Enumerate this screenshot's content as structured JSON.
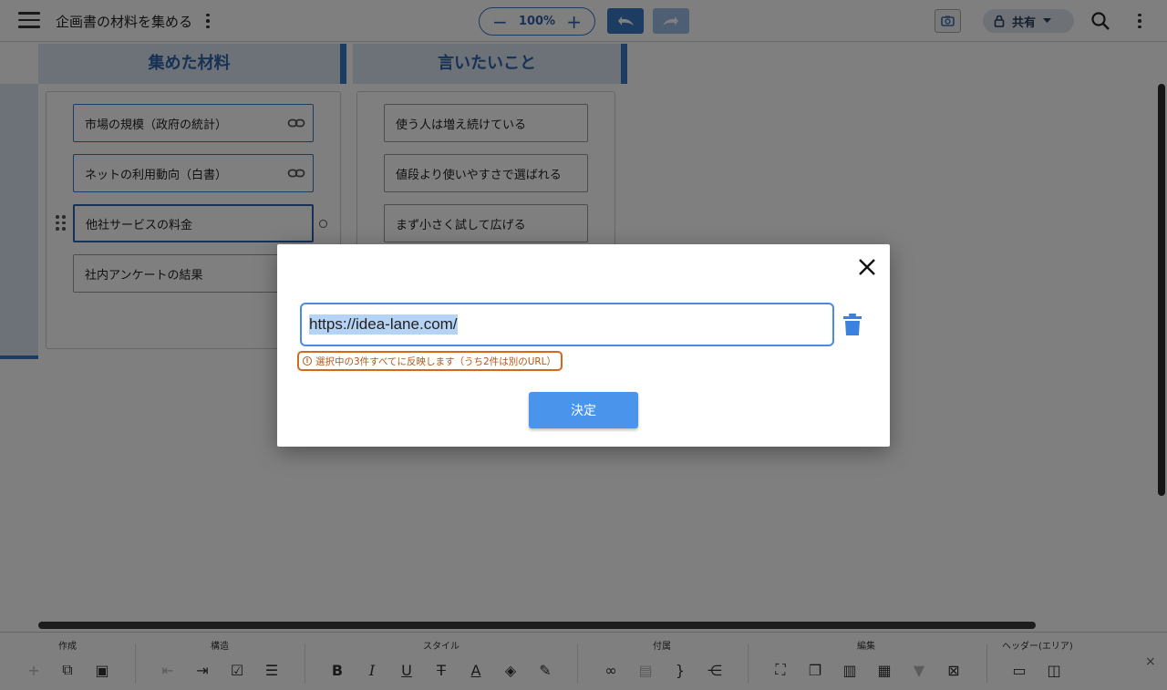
{
  "topbar": {
    "title": "企画書の材料を集める",
    "zoom": {
      "minus": "−",
      "value": "100%",
      "plus": "+"
    },
    "share_label": "共有"
  },
  "board": {
    "columns": [
      {
        "header": "集めた材料",
        "cards": [
          {
            "text": "市場の規模（政府の統計）"
          },
          {
            "text": "ネットの利用動向（白書）"
          },
          {
            "text": "他社サービスの料金"
          },
          {
            "text": "社内アンケートの結果"
          }
        ]
      },
      {
        "header": "言いたいこと",
        "cards": [
          {
            "text": "使う人は増え続けている"
          },
          {
            "text": "値段より使いやすさで選ばれる"
          },
          {
            "text": "まず小さく試して広げる"
          }
        ]
      }
    ]
  },
  "toolbar": {
    "groups": [
      "作成",
      "構造",
      "スタイル",
      "付属",
      "編集",
      "ヘッダー(エリア)"
    ],
    "close": "×"
  },
  "dialog": {
    "url_value": "https://idea-lane.com/",
    "notice": "選択中の3件すべてに反映します（うち2件は別のURL）",
    "confirm_label": "決定"
  },
  "colors": {
    "accent": "#3b78c4",
    "header_bg": "#dbe5f3",
    "notice": "#d2691e",
    "button": "#4a94ec"
  }
}
